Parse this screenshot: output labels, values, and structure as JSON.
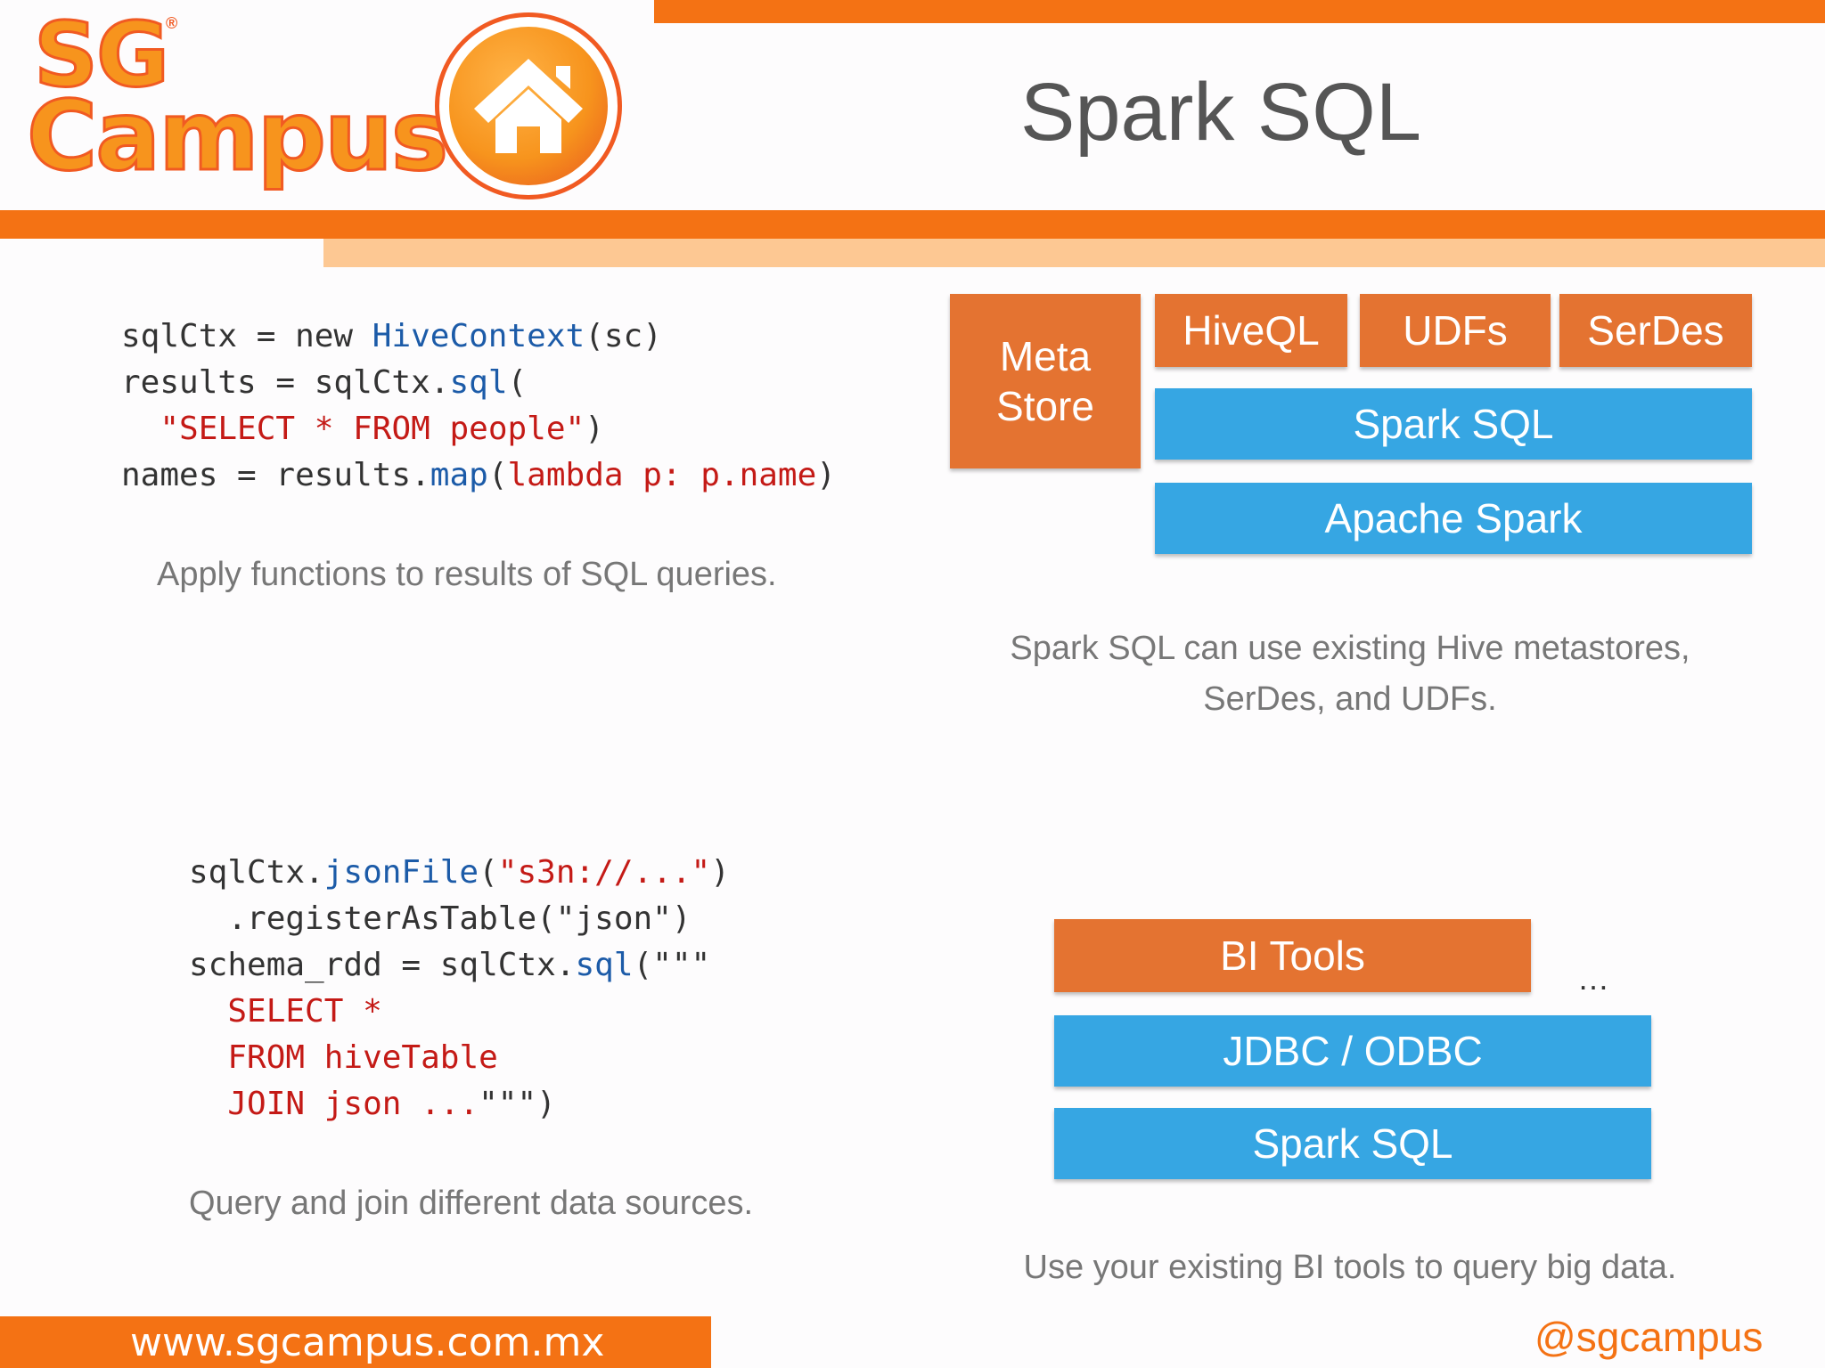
{
  "header": {
    "title": "Spark SQL",
    "logo_line1": "SG",
    "logo_reg": "®",
    "logo_line2": "Campus"
  },
  "top_left": {
    "code": [
      [
        {
          "t": "sqlCtx = new "
        },
        {
          "t": "HiveContext",
          "c": "kw"
        },
        {
          "t": "(sc)"
        }
      ],
      [
        {
          "t": "results = sqlCtx."
        },
        {
          "t": "sql",
          "c": "kw"
        },
        {
          "t": "("
        }
      ],
      [
        {
          "t": "  "
        },
        {
          "t": "\"SELECT * FROM people\"",
          "c": "str"
        },
        {
          "t": ")"
        }
      ],
      [
        {
          "t": "names = results."
        },
        {
          "t": "map",
          "c": "kw"
        },
        {
          "t": "("
        },
        {
          "t": "lambda p: p.name",
          "c": "str"
        },
        {
          "t": ")"
        }
      ]
    ],
    "caption": "Apply functions to results of SQL queries."
  },
  "top_right": {
    "meta_store": "Meta\nStore",
    "hiveql": "HiveQL",
    "udfs": "UDFs",
    "serdes": "SerDes",
    "spark_sql": "Spark SQL",
    "apache_spark": "Apache Spark",
    "caption": "Spark SQL can use existing Hive metastores, SerDes, and UDFs."
  },
  "bottom_left": {
    "code": [
      [
        {
          "t": "sqlCtx."
        },
        {
          "t": "jsonFile",
          "c": "kw"
        },
        {
          "t": "("
        },
        {
          "t": "\"s3n://...\"",
          "c": "str"
        },
        {
          "t": ")"
        }
      ],
      [
        {
          "t": "  .registerAsTable(\"json\")"
        }
      ],
      [
        {
          "t": "schema_rdd = sqlCtx."
        },
        {
          "t": "sql",
          "c": "kw"
        },
        {
          "t": "(\"\"\""
        }
      ],
      [
        {
          "t": "  "
        },
        {
          "t": "SELECT *",
          "c": "str"
        }
      ],
      [
        {
          "t": "  "
        },
        {
          "t": "FROM hiveTable",
          "c": "str"
        }
      ],
      [
        {
          "t": "  "
        },
        {
          "t": "JOIN json ...",
          "c": "str"
        },
        {
          "t": "\"\"\")"
        }
      ]
    ],
    "caption": "Query and join different data sources."
  },
  "bottom_right": {
    "bi_tools": "BI Tools",
    "ellipsis": "…",
    "jdbc_odbc": "JDBC / ODBC",
    "spark_sql": "Spark SQL",
    "caption": "Use your existing BI tools to query big data."
  },
  "footer": {
    "url": "www.sgcampus.com.mx",
    "handle": "@sgcampus"
  },
  "colors": {
    "brand_orange": "#f47214",
    "light_orange": "#fdc893",
    "box_orange": "#e47331",
    "box_blue": "#36a6e3"
  }
}
